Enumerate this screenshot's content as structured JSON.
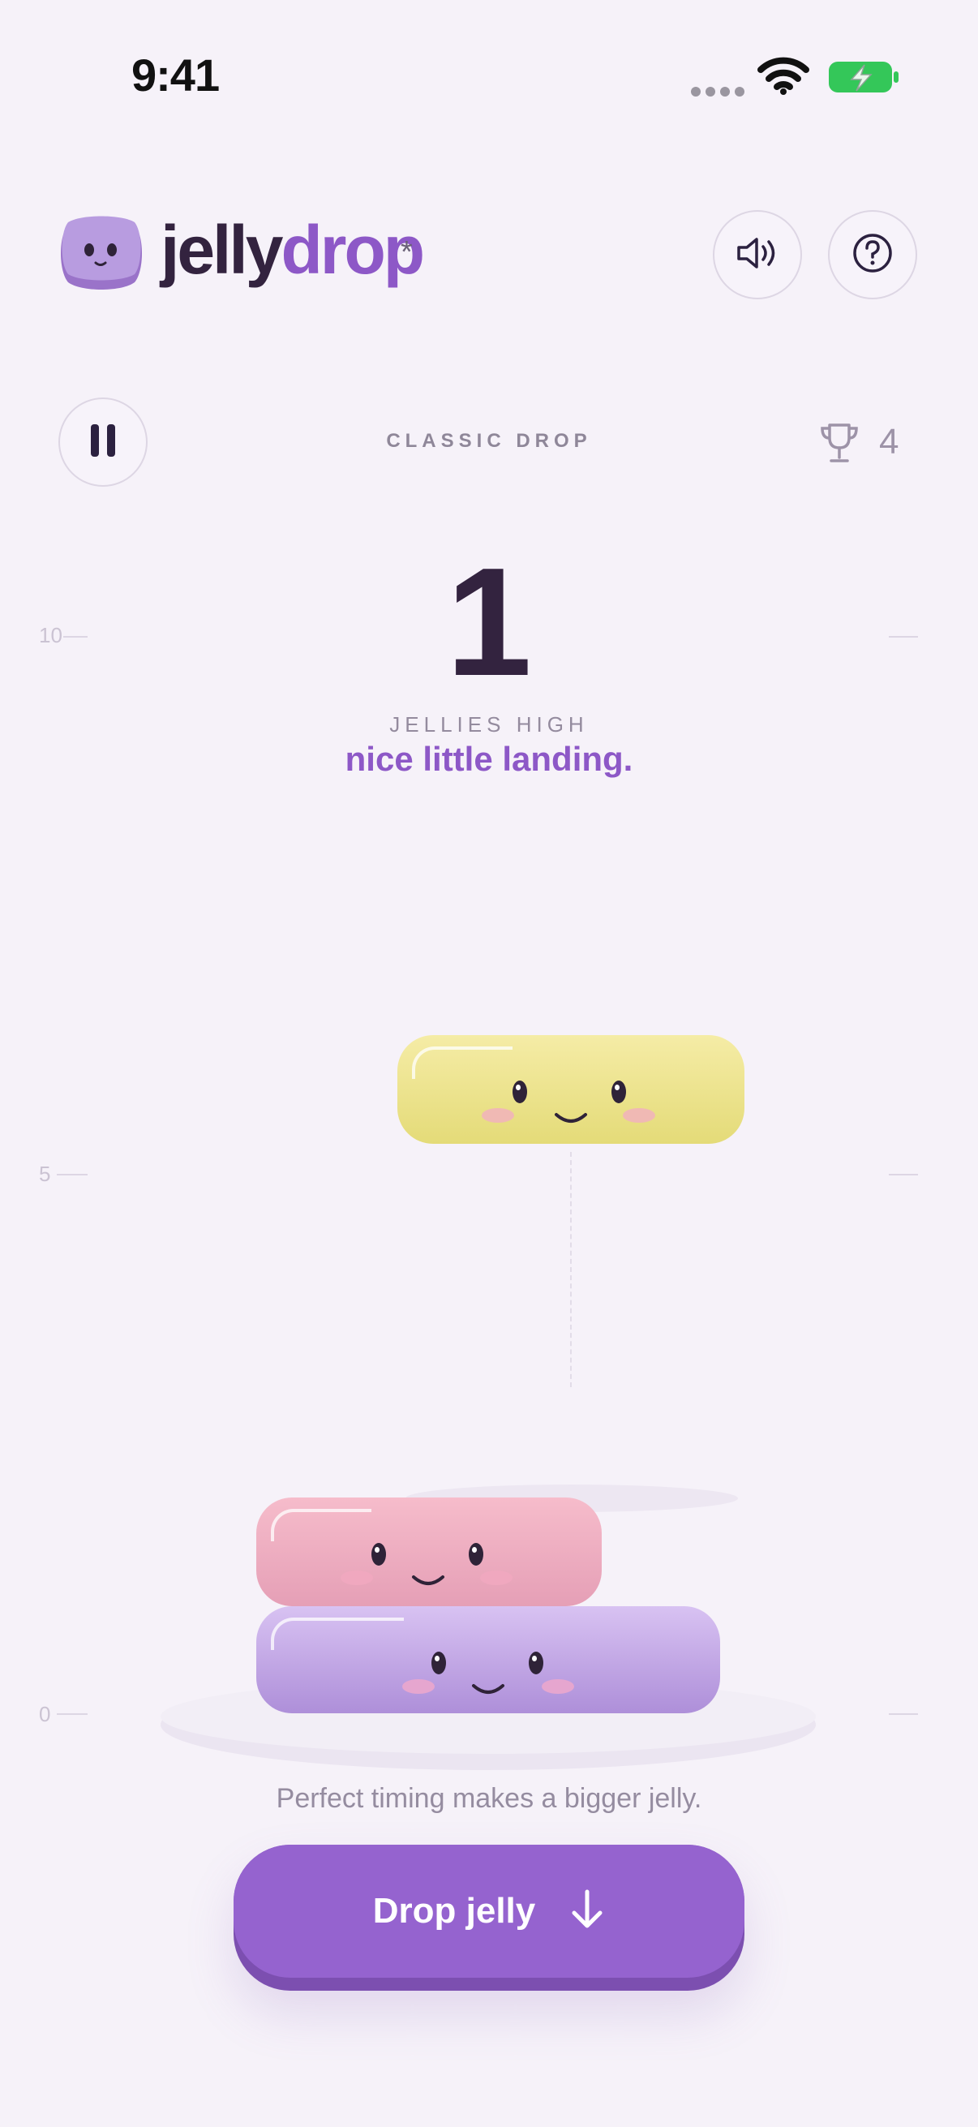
{
  "status": {
    "time": "9:41"
  },
  "header": {
    "logo_part1": "jelly",
    "logo_part2": "drop",
    "logo_mark": "*"
  },
  "game": {
    "mode": "CLASSIC DROP",
    "best": "4",
    "score": "1",
    "score_label": "JELLIES HIGH",
    "message": "nice little landing."
  },
  "scale": {
    "top": "10",
    "mid": "5",
    "bottom": "0"
  },
  "hint": "Perfect timing makes a bigger jelly.",
  "drop_button": {
    "label": "Drop jelly"
  },
  "colors": {
    "accent": "#9563cf",
    "logo_purple": "#8d58c7",
    "jelly_yellow": "#ece47f",
    "jelly_pink": "#eaa3bb",
    "jelly_purple": "#bfa1e3"
  },
  "icons": [
    "signal-dots-icon",
    "wifi-icon",
    "battery-charging-icon",
    "speaker-icon",
    "help-icon",
    "pause-icon",
    "trophy-icon",
    "arrow-down-icon"
  ]
}
